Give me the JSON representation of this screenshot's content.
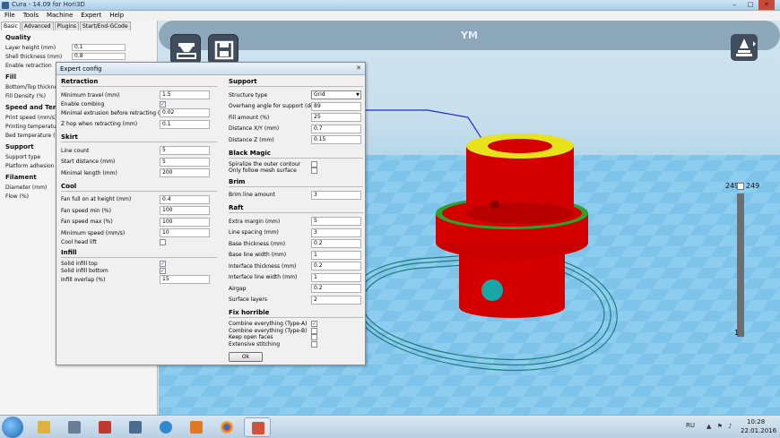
{
  "window": {
    "title": "Cura - 14.09 for Hori3D",
    "min": "–",
    "max": "□",
    "close": "✕"
  },
  "menu": [
    "File",
    "Tools",
    "Machine",
    "Expert",
    "Help"
  ],
  "left_panel": {
    "tabs": [
      "Basic",
      "Advanced",
      "Plugins",
      "Start/End-GCode"
    ],
    "sections": [
      {
        "title": "Quality",
        "rows": [
          {
            "label": "Layer height (mm)",
            "value": "0,1"
          },
          {
            "label": "Shell thickness (mm)",
            "value": "0,8"
          },
          {
            "label": "Enable retraction",
            "value": ""
          }
        ]
      },
      {
        "title": "Fill",
        "rows": [
          {
            "label": "Bottom/Top thickness",
            "value": ""
          },
          {
            "label": "Fill Density (%)",
            "value": ""
          }
        ]
      },
      {
        "title": "Speed and Temperature",
        "rows": [
          {
            "label": "Print speed (mm/s)",
            "value": ""
          },
          {
            "label": "Printing temperature",
            "value": ""
          },
          {
            "label": "Bed temperature (C)",
            "value": ""
          }
        ]
      },
      {
        "title": "Support",
        "rows": [
          {
            "label": "Support type",
            "value": ""
          },
          {
            "label": "Platform adhesion type",
            "value": ""
          }
        ]
      },
      {
        "title": "Filament",
        "rows": [
          {
            "label": "Diameter (mm)",
            "value": ""
          },
          {
            "label": "Flow (%)",
            "value": ""
          }
        ]
      }
    ]
  },
  "viewport": {
    "ym_label": "YM",
    "layer_top": "249",
    "layer_top_right": "249",
    "layer_bottom": "1"
  },
  "dialog": {
    "title": "Expert config",
    "close": "✕",
    "ok_label": "Ok",
    "retraction": {
      "title": "Retraction",
      "min_travel_label": "Minimum travel (mm)",
      "min_travel": "1.5",
      "combing_label": "Enable combing",
      "combing": "✓",
      "min_extrusion_label": "Minimal extrusion before retracting (mm)",
      "min_extrusion": "0.02",
      "zhop_label": "Z hop when retracting (mm)",
      "zhop": "0.1"
    },
    "skirt": {
      "title": "Skirt",
      "line_count_label": "Line count",
      "line_count": "5",
      "start_distance_label": "Start distance (mm)",
      "start_distance": "5",
      "min_length_label": "Minimal length (mm)",
      "min_length": "200"
    },
    "cool": {
      "title": "Cool",
      "fan_full_label": "Fan full on at height (mm)",
      "fan_full": "0.4",
      "fan_min_label": "Fan speed min (%)",
      "fan_min": "100",
      "fan_max_label": "Fan speed max (%)",
      "fan_max": "100",
      "min_speed_label": "Minimum speed (mm/s)",
      "min_speed": "10",
      "cool_head_lift_label": "Cool head lift",
      "cool_head_lift": ""
    },
    "infill": {
      "title": "Infill",
      "solid_top_label": "Solid infill top",
      "solid_top": "✓",
      "solid_bottom_label": "Solid infill bottom",
      "solid_bottom": "✓",
      "overlap_label": "Infill overlap (%)",
      "overlap": "15"
    },
    "support": {
      "title": "Support",
      "structure_label": "Structure type",
      "structure": "Grid",
      "overhang_label": "Overhang angle for support (deg)",
      "overhang": "89",
      "fill_amount_label": "Fill amount (%)",
      "fill_amount": "25",
      "distance_xy_label": "Distance X/Y (mm)",
      "distance_xy": "0,7",
      "distance_z_label": "Distance Z (mm)",
      "distance_z": "0.15"
    },
    "black_magic": {
      "title": "Black Magic",
      "spiralize_label": "Spiralize the outer contour",
      "spiralize": "",
      "only_mesh_label": "Only follow mesh surface",
      "only_mesh": ""
    },
    "brim": {
      "title": "Brim",
      "line_amount_label": "Brim line amount",
      "line_amount": "3"
    },
    "raft": {
      "title": "Raft",
      "extra_margin_label": "Extra margin (mm)",
      "extra_margin": "5",
      "line_spacing_label": "Line spacing (mm)",
      "line_spacing": "3",
      "base_thickness_label": "Base thickness (mm)",
      "base_thickness": "0.2",
      "base_line_width_label": "Base line width (mm)",
      "base_line_width": "1",
      "interface_thickness_label": "Interface thickness (mm)",
      "interface_thickness": "0.2",
      "interface_line_width_label": "Interface line width (mm)",
      "interface_line_width": "1",
      "airgap_label": "Airgap",
      "airgap": "0.2",
      "surface_layers_label": "Surface layers",
      "surface_layers": "2"
    },
    "fix_horrible": {
      "title": "Fix horrible",
      "type_a_label": "Combine everything (Type-A)",
      "type_a": "✓",
      "type_b_label": "Combine everything (Type-B)",
      "type_b": "",
      "open_faces_label": "Keep open faces",
      "open_faces": "",
      "extensive_label": "Extensive stitching",
      "extensive": ""
    }
  },
  "taskbar": {
    "lang": "RU",
    "tray": "▲ ⚑ ♪",
    "time": "10:28",
    "date": "22.01.2016"
  }
}
